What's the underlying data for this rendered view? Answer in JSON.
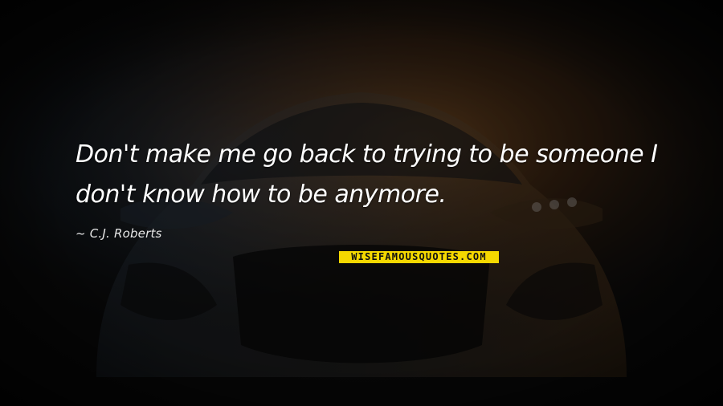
{
  "quote": {
    "text": "Don't make me go back to trying to be someone I don't know how to be anymore.",
    "author": "C.J. Roberts"
  },
  "watermark": {
    "text": "WISEFAMOUSQUOTES.COM",
    "background": "#f5d800",
    "color": "#111111"
  },
  "colors": {
    "background": "#0a0a0a",
    "quote_text": "#ffffff",
    "glow_warm": "#c8782a",
    "glow_cool": "#3a5a78"
  }
}
